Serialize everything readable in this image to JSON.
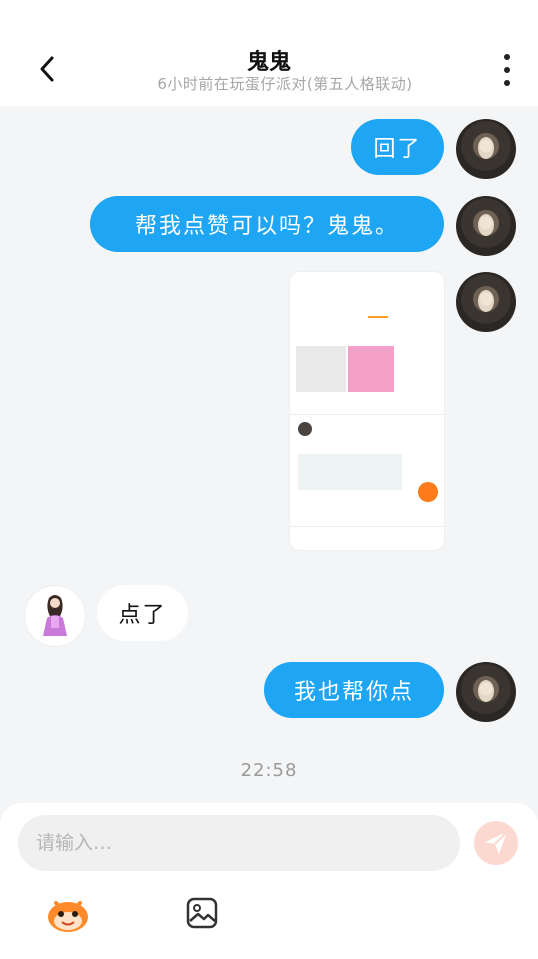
{
  "header": {
    "title": "鬼鬼",
    "subtitle": "6小时前在玩蛋仔派对(第五人格联动)"
  },
  "messages": [
    {
      "side": "me",
      "text": "回了"
    },
    {
      "side": "me",
      "text": "帮我点赞可以吗？鬼鬼。"
    },
    {
      "side": "me",
      "type": "image"
    },
    {
      "side": "other",
      "text": "点了"
    },
    {
      "side": "me",
      "text": "我也帮你点"
    }
  ],
  "timestamp": "22:58",
  "composer": {
    "placeholder": "请输入…"
  },
  "colors": {
    "bubble_me": "#1ea6f5",
    "accent": "#ff7a1a"
  },
  "icons": [
    "back-arrow-icon",
    "more-vertical-icon",
    "send-icon",
    "emoji-icon",
    "image-icon"
  ]
}
